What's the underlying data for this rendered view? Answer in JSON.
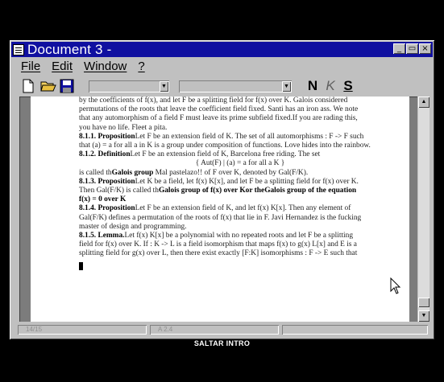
{
  "window": {
    "title": "Document 3 -",
    "controls": {
      "minimize": "_",
      "maximize": "▭",
      "close": "×"
    }
  },
  "menu": {
    "items": [
      {
        "label": "File"
      },
      {
        "label": "Edit"
      },
      {
        "label": "Window"
      },
      {
        "label": "?"
      }
    ]
  },
  "toolbar": {
    "icons": [
      "new-document-icon",
      "open-folder-icon",
      "save-disk-icon"
    ],
    "font_combo_value": "",
    "size_combo_value": "",
    "bold_label": "N",
    "italic_label": "K",
    "underline_label": "S"
  },
  "document": {
    "lines": [
      "by the coefficients of f(x), and let F be a splitting field for f(x) over K. Galois considered",
      "permutations of the roots that leave the coefficient field fixed. Santi  has an iron ass. We note",
      "that any automorphism of a field F must leave its prime subfield fixed.If you are rading this,",
      "you have no life. Fleet a pita."
    ],
    "def_811_num": "8.1.1. Proposition",
    "def_811_text": "Let F be an extension field of K. The set of all automorphisms : F -> F such",
    "line_811b": "that (a) = a for all a in K is a group under composition of functions. Love hides into the rainbow.",
    "def_812_num": "8.1.2. Definition",
    "def_812_text": "Let F be an extension field of K, Barcelona free riding. The set",
    "set_line": "{ Aut(F) | (a) = a for all a K }",
    "line_812c_pre": "is called th",
    "line_812c_bold": "Galois group",
    "line_812c_post": " Mal pastelazo!! of F over K, denoted by Gal(F/K).",
    "def_813_num": "8.1.3. Proposition",
    "def_813_text": "Let K be a field, let f(x) K[x], and let F be a splitting field for f(x) over K.",
    "line_813b_pre": "Then Gal(F/K) is called th",
    "line_813b_bold": "Galois group of f(x) over Kor the",
    "line_813b_bold2": "Galois group of the equation",
    "line_813c": "f(x) = 0 over K",
    "def_814_num": "8.1.4. Proposition",
    "def_814_text": "Let F be an extension field of K, and let f(x) K[x]. Then any element of",
    "line_814b": "Gal(F/K) defines a permutation of the roots of f(x) that lie in F.  Javi Hernandez is the fucking",
    "line_814c": "master of design and programming.",
    "def_815_num": "8.1.5. Lemma.",
    "def_815_text": "Let f(x) K[x] be a polynomial with no repeated roots and let F be a splitting",
    "line_815b": "field for f(x) over K. If : K -> L is a field isomorphism that maps f(x) to g(x) L[x] and E is a",
    "line_815c": "splitting field for g(x) over L, then there exist exactly [F:K] isomorphisms : F -> E such that"
  },
  "scrollbar": {
    "up": "▲",
    "down": "▼"
  },
  "status": {
    "page": "14/15",
    "position": "A 2.4",
    "extra": ""
  },
  "footer": {
    "label": "SALTAR INTRO"
  }
}
